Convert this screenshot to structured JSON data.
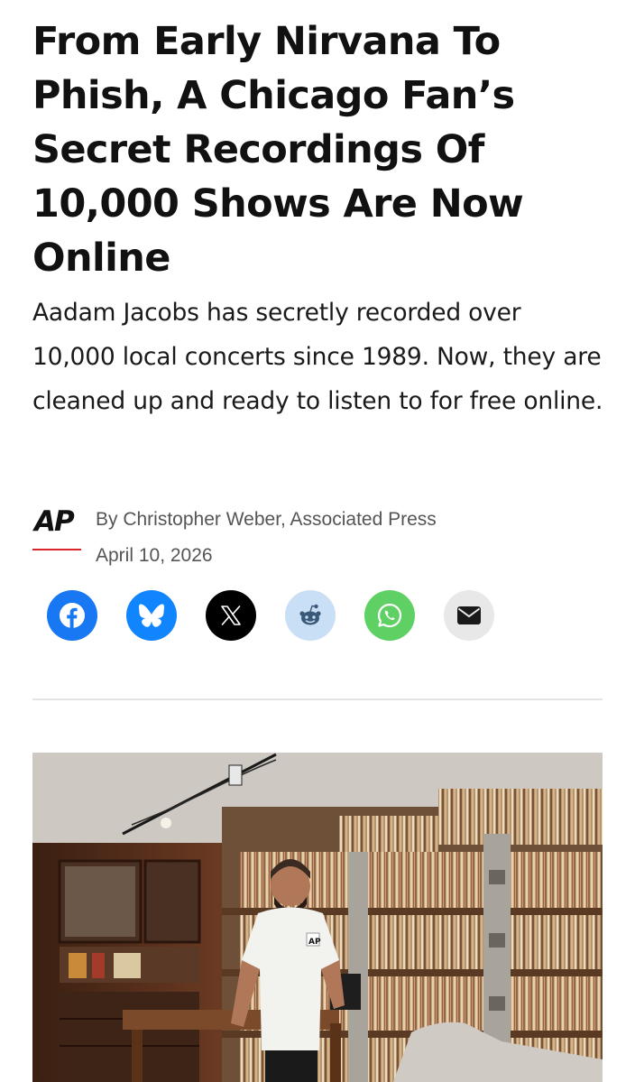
{
  "article": {
    "headline": "From Early Nirvana To Phish, A Chicago Fan’s Secret Recordings Of 10,000 Shows Are Now Online",
    "dek": "Aadam Jacobs has secretly recorded over 10,000 local concerts since 1989. Now, they are cleaned up and ready to listen to for free online.",
    "byline": "By Christopher Weber, Associated Press",
    "date": "April 10, 2026",
    "source_logo": "AP"
  },
  "share": {
    "buttons": [
      {
        "icon": "facebook-icon",
        "color": "#1877f2"
      },
      {
        "icon": "bluesky-icon",
        "color": "#1185fe"
      },
      {
        "icon": "x-icon",
        "color": "#000000"
      },
      {
        "icon": "reddit-icon",
        "color": "#c9dff5"
      },
      {
        "icon": "whatsapp-icon",
        "color": "#5fd063"
      },
      {
        "icon": "email-icon",
        "color": "#e8e8e8"
      }
    ]
  },
  "photo": {
    "shirt_logo": "AP"
  },
  "colors": {
    "accent_red": "#d9242b",
    "text": "#111111",
    "meta_text": "#555555"
  }
}
